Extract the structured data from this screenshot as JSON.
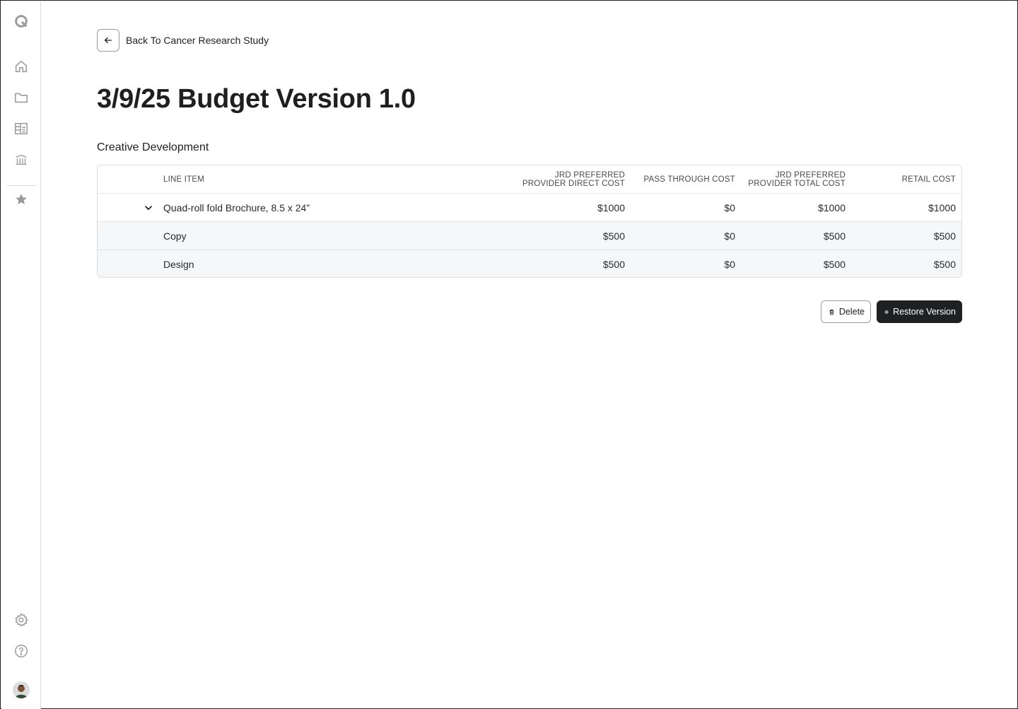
{
  "back": {
    "label": "Back To Cancer Research Study"
  },
  "page": {
    "title": "3/9/25 Budget Version 1.0"
  },
  "section": {
    "title": "Creative Development"
  },
  "table": {
    "headers": {
      "line_item": "LINE ITEM",
      "direct_line1": "JRD PREFERRED",
      "direct_line2": "PROVIDER DIRECT COST",
      "pass": "PASS THROUGH COST",
      "total_line1": "JRD PREFERRED",
      "total_line2": "PROVIDER TOTAL COST",
      "retail": "RETAIL COST"
    },
    "rows": [
      {
        "item": "Quad-roll fold Brochure, 8.5 x 24”",
        "direct": "$1000",
        "pass": "$0",
        "total": "$1000",
        "retail": "$1000"
      },
      {
        "item": "Copy",
        "direct": "$500",
        "pass": "$0",
        "total": "$500",
        "retail": "$500"
      },
      {
        "item": "Design",
        "direct": "$500",
        "pass": "$0",
        "total": "$500",
        "retail": "$500"
      }
    ]
  },
  "actions": {
    "delete_label": "Delete",
    "restore_label": "Restore Version"
  },
  "icons": {
    "logo": "logo-icon",
    "home": "home-icon",
    "folder": "folder-icon",
    "table": "table-icon",
    "bank": "bank-icon",
    "star": "star-icon",
    "settings": "gear-icon",
    "help": "help-icon"
  },
  "colors": {
    "primary_button": "#1f2022",
    "row_alt": "#f6f7f8",
    "icon": "#9a9a9a"
  }
}
